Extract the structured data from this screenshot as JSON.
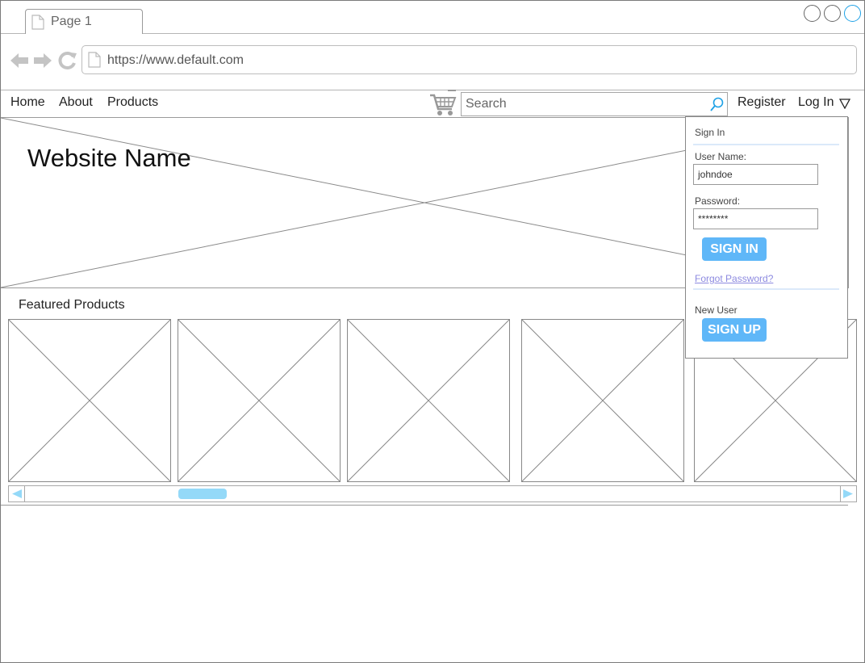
{
  "browser": {
    "tab_title": "Page 1",
    "url": "https://www.default.com"
  },
  "nav": {
    "items": [
      "Home",
      "About",
      "Products"
    ],
    "search_placeholder": "Search",
    "register": "Register",
    "login": "Log In"
  },
  "banner": {
    "site_name": "Website Name"
  },
  "featured": {
    "title": "Featured Products"
  },
  "login_panel": {
    "title": "Sign In",
    "username_label": "User Name:",
    "username_value": "johndoe",
    "password_label": "Password:",
    "password_value": "********",
    "sign_in_button": "SIGN IN",
    "forgot_password": "Forgot Password?",
    "new_user_label": "New User",
    "sign_up_button": "SIGN UP"
  },
  "colors": {
    "accent": "#5fb7f8",
    "scroll_thumb": "#94d9f8",
    "link": "#8d8ae0",
    "icon_gray": "#c4c4c4"
  }
}
